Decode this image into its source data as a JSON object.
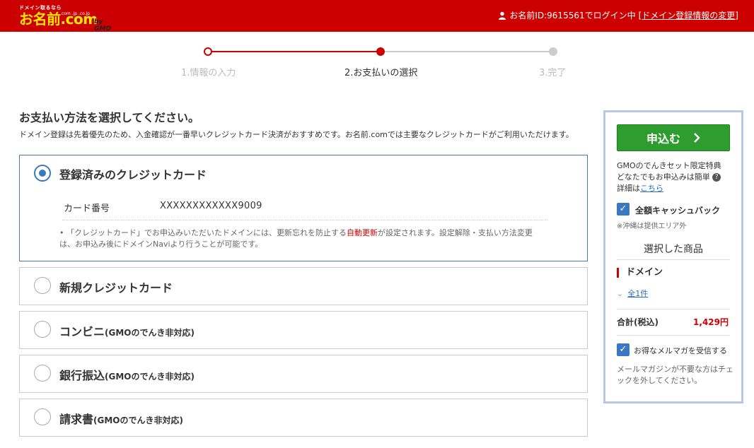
{
  "header": {
    "logo_tag": "ドメイン取るなら",
    "logo_main": "お名前.com",
    "logo_tld": ".com .jp .co.jp",
    "logo_by": "by GMO",
    "login_text": "お名前ID:9615561でログイン中",
    "login_link": "[ドメイン登録情報の変更]"
  },
  "stepper": {
    "steps": [
      "1.情報の入力",
      "2.お支払いの選択",
      "3.完了"
    ]
  },
  "main": {
    "title": "お支払い方法を選択してください。",
    "subtitle": "ドメイン登録は先着優先のため、入金確認が一番早いクレジットカード決済がおすすめです。お名前.comでは主要なクレジットカードがご利用いただけます。",
    "options": [
      {
        "label": "登録済みのクレジットカード",
        "note": "",
        "selected": true
      },
      {
        "label": "新規クレジットカード",
        "note": "",
        "selected": false
      },
      {
        "label": "コンビニ",
        "note": "(GMOのでんき非対応)",
        "selected": false
      },
      {
        "label": "銀行振込",
        "note": "(GMOのでんき非対応)",
        "selected": false
      },
      {
        "label": "請求書",
        "note": "(GMOのでんき非対応)",
        "selected": false
      }
    ],
    "card": {
      "key": "カード番号",
      "value": "XXXXXXXXXXXX9009"
    },
    "note_prefix": "「クレジットカード」でお申込みいただいたドメインには、更新忘れを防止する",
    "note_red": "自動更新",
    "note_suffix": "が設定されます。設定解除・支払い方法変更は、お申込み後にドメインNaviより行うことが可能です。"
  },
  "sidebar": {
    "apply_label": "申込む",
    "promo_line1": "GMOのでんきセット限定特典",
    "promo_line2": "どなたでもお申込みは簡単",
    "promo_detail": "詳細は",
    "promo_link": "こちら",
    "cashback_label": "全額キャッシュバック",
    "okinawa_note": "※沖縄は提供エリア外",
    "selected_title": "選択した商品",
    "domain_heading": "ドメイン",
    "domain_count": "全1件",
    "total_label": "合計(税込)",
    "total_value": "1,429円",
    "newsletter_label": "お得なメルマガを受信する",
    "newsletter_note": "メールマガジンが不要な方はチェックを外してください。"
  }
}
